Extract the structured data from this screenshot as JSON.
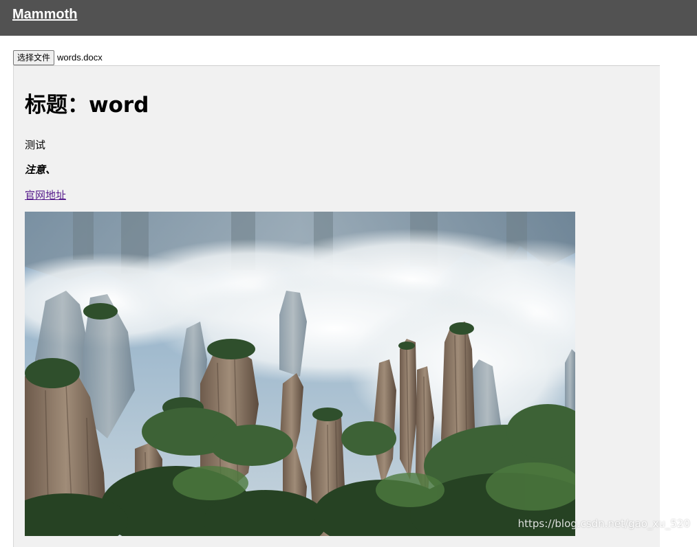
{
  "header": {
    "brand": "Mammoth",
    "bg_color": "#525252"
  },
  "file_input": {
    "button_label": "选择文件",
    "file_name": "words.docx"
  },
  "document": {
    "title": "标题：word",
    "paragraph": "测试",
    "note": "注意、",
    "link_text": "官网地址",
    "link_color": "#551a8b",
    "image": {
      "subject": "Misty sandstone pillar mountains with green trees"
    },
    "bg_color": "#f1f1f1"
  },
  "watermark": "https://blog.csdn.net/gao_xu_520"
}
